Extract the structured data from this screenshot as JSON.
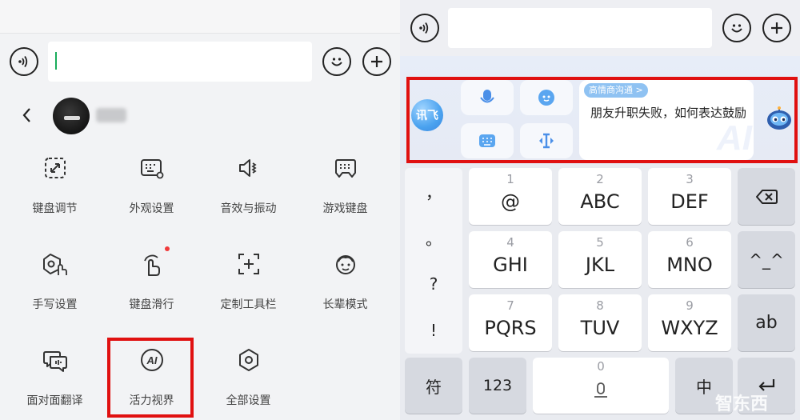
{
  "left": {
    "header": {
      "back_icon": "chevron-left-icon"
    },
    "grid": [
      {
        "label": "键盘调节",
        "icon": "keyboard-resize-icon"
      },
      {
        "label": "外观设置",
        "icon": "appearance-icon"
      },
      {
        "label": "音效与振动",
        "icon": "sound-vibration-icon"
      },
      {
        "label": "游戏键盘",
        "icon": "game-keyboard-icon"
      },
      {
        "label": "手写设置",
        "icon": "handwriting-icon"
      },
      {
        "label": "键盘滑行",
        "icon": "swipe-icon"
      },
      {
        "label": "定制工具栏",
        "icon": "custom-toolbar-icon"
      },
      {
        "label": "长辈模式",
        "icon": "elder-mode-icon"
      },
      {
        "label": "面对面翻译",
        "icon": "face-translate-icon"
      },
      {
        "label": "活力视界",
        "icon": "ai-icon"
      },
      {
        "label": "全部设置",
        "icon": "settings-icon"
      }
    ],
    "ai_badge": "AI"
  },
  "right": {
    "ai_panel": {
      "logo_text": "讯飞",
      "tag": "高情商沟通 >",
      "suggestion": "朋友升职失败，如何表达鼓励",
      "watermark": "AI"
    },
    "symbols": [
      "，",
      "。",
      "?",
      "!"
    ],
    "keys": [
      {
        "num": "1",
        "main": "@"
      },
      {
        "num": "2",
        "main": "ABC"
      },
      {
        "num": "3",
        "main": "DEF"
      },
      {
        "num": "4",
        "main": "GHI"
      },
      {
        "num": "5",
        "main": "JKL"
      },
      {
        "num": "6",
        "main": "MNO"
      },
      {
        "num": "7",
        "main": "PQRS"
      },
      {
        "num": "8",
        "main": "TUV"
      },
      {
        "num": "9",
        "main": "WXYZ"
      }
    ],
    "func": {
      "emoticon": "^_^",
      "ab": "ab",
      "fu": "符",
      "num123": "123",
      "zero": "0",
      "zhong": "中"
    },
    "watermark": "智东西"
  },
  "colors": {
    "highlight": "#e01010",
    "caret": "#1aad5b",
    "accent_blue": "#4aa2ef"
  }
}
